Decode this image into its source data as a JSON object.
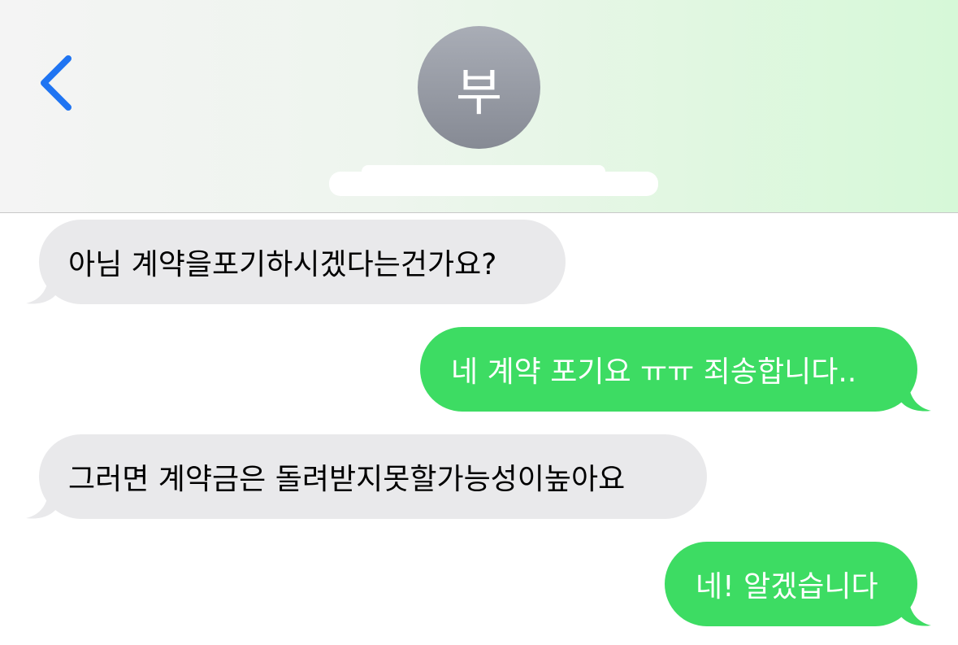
{
  "header": {
    "avatar_initial": "부",
    "back_icon": "chevron-left-icon",
    "accent_color": "#1f74f2"
  },
  "messages": [
    {
      "direction": "incoming",
      "text": "아님 계약을포기하시겠다는건가요?"
    },
    {
      "direction": "outgoing",
      "text": "네 계약 포기요 ㅠㅠ 죄송합니다.."
    },
    {
      "direction": "incoming",
      "text": "그러면 계약금은 돌려받지못할가능성이높아요"
    },
    {
      "direction": "outgoing",
      "text": "네! 알겠습니다"
    }
  ],
  "colors": {
    "incoming_bubble": "#e9e9eb",
    "outgoing_bubble": "#3ddc63"
  }
}
